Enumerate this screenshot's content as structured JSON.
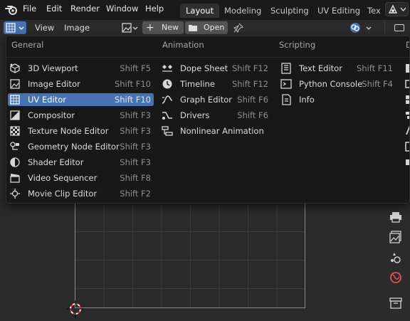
{
  "topbar": {
    "menus": [
      "File",
      "Edit",
      "Render",
      "Window",
      "Help"
    ],
    "workspaces": [
      "Layout",
      "Modeling",
      "Sculpting",
      "UV Editing",
      "Tex"
    ],
    "active_workspace": "Layout"
  },
  "header": {
    "view_label": "View",
    "image_label": "Image",
    "new_label": "New",
    "open_label": "Open"
  },
  "editor_menu": {
    "columns": [
      {
        "title": "General",
        "items": [
          {
            "label": "3D Viewport",
            "shortcut": "Shift F5",
            "icon": "viewport-3d-icon"
          },
          {
            "label": "Image Editor",
            "shortcut": "Shift F10",
            "icon": "image-editor-icon"
          },
          {
            "label": "UV Editor",
            "shortcut": "Shift F10",
            "icon": "uv-editor-icon",
            "active": true
          },
          {
            "label": "Compositor",
            "shortcut": "Shift F3",
            "icon": "compositor-icon"
          },
          {
            "label": "Texture Node Editor",
            "shortcut": "Shift F3",
            "icon": "texture-node-icon"
          },
          {
            "label": "Geometry Node Editor",
            "shortcut": "Shift F3",
            "icon": "geometry-node-icon"
          },
          {
            "label": "Shader Editor",
            "shortcut": "Shift F3",
            "icon": "shader-editor-icon"
          },
          {
            "label": "Video Sequencer",
            "shortcut": "Shift F8",
            "icon": "video-sequencer-icon"
          },
          {
            "label": "Movie Clip Editor",
            "shortcut": "Shift F2",
            "icon": "movie-clip-icon"
          }
        ]
      },
      {
        "title": "Animation",
        "items": [
          {
            "label": "Dope Sheet",
            "shortcut": "Shift F12",
            "icon": "dope-sheet-icon"
          },
          {
            "label": "Timeline",
            "shortcut": "Shift F12",
            "icon": "timeline-icon"
          },
          {
            "label": "Graph Editor",
            "shortcut": "Shift F6",
            "icon": "graph-editor-icon"
          },
          {
            "label": "Drivers",
            "shortcut": "Shift F6",
            "icon": "drivers-icon"
          },
          {
            "label": "Nonlinear Animation",
            "shortcut": "",
            "icon": "nla-icon"
          }
        ]
      },
      {
        "title": "Scripting",
        "items": [
          {
            "label": "Text Editor",
            "shortcut": "Shift F11",
            "icon": "text-editor-icon"
          },
          {
            "label": "Python Console",
            "shortcut": "Shift F4",
            "icon": "python-console-icon"
          },
          {
            "label": "Info",
            "shortcut": "",
            "icon": "info-icon"
          }
        ]
      },
      {
        "title": "D",
        "items": []
      }
    ]
  },
  "colors": {
    "accent": "#4772b3",
    "menu_bg": "#181818",
    "viewport_bg": "#2a2a2a"
  }
}
